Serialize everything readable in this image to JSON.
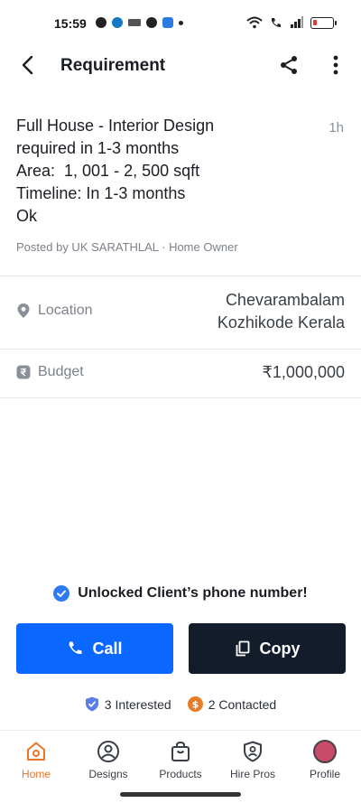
{
  "status_bar": {
    "time": "15:59"
  },
  "app_bar": {
    "title": "Requirement"
  },
  "requirement": {
    "lines": [
      "Full House - Interior Design",
      "required in 1-3 months",
      "Area:  1, 001 - 2, 500 sqft",
      "Timeline: In 1-3 months",
      "Ok"
    ],
    "time_ago": "1h",
    "posted_by": "Posted by UK SARATHLAL · Home Owner"
  },
  "details": {
    "location": {
      "label": "Location",
      "value_line1": "Chevarambalam",
      "value_line2": "Kozhikode Kerala"
    },
    "budget": {
      "label": "Budget",
      "value": "₹1,000,000"
    }
  },
  "unlock_message": "Unlocked Client’s phone number!",
  "actions": {
    "call_label": "Call",
    "copy_label": "Copy"
  },
  "stats": {
    "interested": "3 Interested",
    "contacted": "2 Contacted"
  },
  "bottom_nav": {
    "home": "Home",
    "designs": "Designs",
    "products": "Products",
    "hire_pros": "Hire Pros",
    "profile": "Profile"
  },
  "colors": {
    "accent_blue": "#0a67ff",
    "dark_button": "#131c2b",
    "active_nav": "#e8742a",
    "muted_text": "#7c818a"
  }
}
